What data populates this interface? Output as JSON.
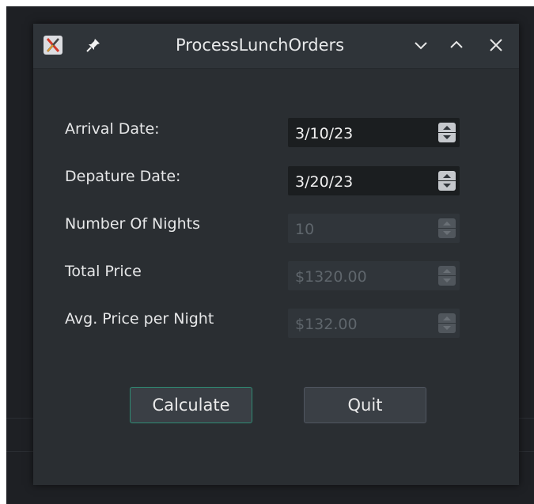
{
  "window": {
    "title": "ProcessLunchOrders"
  },
  "form": {
    "rows": [
      {
        "label": "Arrival Date:",
        "value": "3/10/23",
        "enabled": true
      },
      {
        "label": "Depature Date:",
        "value": "3/20/23",
        "enabled": true
      },
      {
        "label": "Number Of Nights",
        "value": "10",
        "enabled": false
      },
      {
        "label": "Total Price",
        "value": "$1320.00",
        "enabled": false
      },
      {
        "label": "Avg. Price per Night",
        "value": "$132.00",
        "enabled": false
      }
    ]
  },
  "buttons": {
    "calculate": "Calculate",
    "quit": "Quit"
  },
  "colors": {
    "accent": "#2e8b73",
    "window_bg": "#2a2e32",
    "titlebar_bg": "#2f3439"
  }
}
